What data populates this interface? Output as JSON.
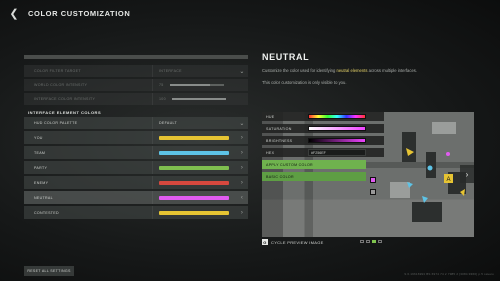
{
  "header": {
    "title": "COLOR CUSTOMIZATION",
    "back_icon": "chevron-left-icon"
  },
  "left": {
    "settings": [
      {
        "label": "COLOR FILTER TARGET",
        "value": "INTERFACE",
        "enabled": false
      },
      {
        "label": "WORLD COLOR INTENSITY",
        "value": "75",
        "level": 0.75,
        "enabled": false
      },
      {
        "label": "INTERFACE COLOR INTENSITY",
        "value": "100",
        "level": 1.0,
        "enabled": false
      }
    ],
    "section_title": "INTERFACE ELEMENT COLORS",
    "palette": {
      "label": "HUD COLOR PALETTE",
      "value": "DEFAULT"
    },
    "colors": [
      {
        "label": "YOU",
        "color": "#e6c433"
      },
      {
        "label": "TEAM",
        "color": "#5dc3e6"
      },
      {
        "label": "PARTY",
        "color": "#7fbf4f"
      },
      {
        "label": "ENEMY",
        "color": "#d6483e"
      },
      {
        "label": "NEUTRAL",
        "color": "#e05cf0"
      },
      {
        "label": "CONTESTED",
        "color": "#e6c433"
      }
    ],
    "reset_label": "RESET ALL SETTINGS"
  },
  "right": {
    "title": "NEUTRAL",
    "desc_before": "Customize the color used for identifying ",
    "desc_highlight": "neutral elements",
    "desc_after": " across multiple interfaces.",
    "desc2": "This color customization is only visible to you.",
    "picker": {
      "hue_label": "HUE",
      "saturation_label": "SATURATION",
      "brightness_label": "BRIGHTNESS",
      "hex_label": "HEX",
      "hex_value": "#F256EF",
      "apply_label": "APPLY CUSTOM COLOR",
      "basic_label": "BASIC COLOR"
    },
    "cycle_key": "G",
    "cycle_label": "CYCLE PREVIEW IMAGE",
    "accent": "#7fc44e"
  },
  "footer": {
    "build": "9.6.19616993 BS 6974 74 2 7985 2 [3084:9360] p.5 saveio"
  }
}
